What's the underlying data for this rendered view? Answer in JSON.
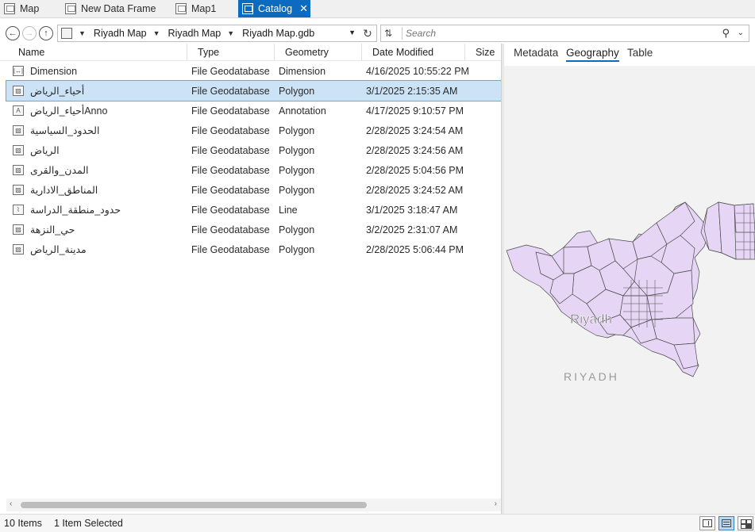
{
  "tabs": [
    {
      "label": "Map",
      "active": false
    },
    {
      "label": "New Data Frame",
      "active": false
    },
    {
      "label": "Map1",
      "active": false
    },
    {
      "label": "Catalog",
      "active": true
    }
  ],
  "address": {
    "crumbs": [
      "Riyadh Map",
      "Riyadh Map",
      "Riyadh Map.gdb"
    ]
  },
  "search": {
    "placeholder": "Search"
  },
  "columns": {
    "name": "Name",
    "type": "Type",
    "geometry": "Geometry",
    "date": "Date Modified",
    "size": "Size"
  },
  "rows": [
    {
      "name": "Dimension",
      "type": "File Geodatabase F",
      "geometry": "Dimension",
      "date": "4/16/2025 10:55:22 PM",
      "icon": "dimension-icon"
    },
    {
      "name": "أحياء_الرياض",
      "type": "File Geodatabase F",
      "geometry": "Polygon",
      "date": "3/1/2025 2:15:35 AM",
      "icon": "polygon-icon",
      "selected": true
    },
    {
      "name": "أحياء_الرياضAnno",
      "type": "File Geodatabase F",
      "geometry": "Annotation",
      "date": "4/17/2025 9:10:57 PM",
      "icon": "annotation-icon"
    },
    {
      "name": "الحدود_السياسية",
      "type": "File Geodatabase F",
      "geometry": "Polygon",
      "date": "2/28/2025 3:24:54 AM",
      "icon": "polygon-icon"
    },
    {
      "name": "الرياض",
      "type": "File Geodatabase F",
      "geometry": "Polygon",
      "date": "2/28/2025 3:24:56 AM",
      "icon": "polygon-icon"
    },
    {
      "name": "المدن_والقرى",
      "type": "File Geodatabase F",
      "geometry": "Polygon",
      "date": "2/28/2025 5:04:56 PM",
      "icon": "polygon-icon"
    },
    {
      "name": "المناطق_الادارية",
      "type": "File Geodatabase F",
      "geometry": "Polygon",
      "date": "2/28/2025 3:24:52 AM",
      "icon": "polygon-icon"
    },
    {
      "name": "حدود_منطقة_الدراسة",
      "type": "File Geodatabase F",
      "geometry": "Line",
      "date": "3/1/2025 3:18:47 AM",
      "icon": "line-icon"
    },
    {
      "name": "حي_النزهة",
      "type": "File Geodatabase F",
      "geometry": "Polygon",
      "date": "3/2/2025 2:31:07 AM",
      "icon": "polygon-icon"
    },
    {
      "name": "مدينة_الرياض",
      "type": "File Geodatabase F",
      "geometry": "Polygon",
      "date": "2/28/2025 5:06:44 PM",
      "icon": "polygon-icon"
    }
  ],
  "preview": {
    "tabs": [
      "Metadata",
      "Geography",
      "Table"
    ],
    "active_tab": "Geography",
    "map_labels": {
      "city_en": "Riyadh",
      "region_caps": "RIYADH"
    },
    "polygon_fill": "#e6d5f5",
    "polygon_stroke": "#4a4a4a"
  },
  "status": {
    "items": "10 Items",
    "selected": "1 Item Selected"
  },
  "colors": {
    "accent": "#0a6bc1",
    "selection": "#cce3f7"
  }
}
